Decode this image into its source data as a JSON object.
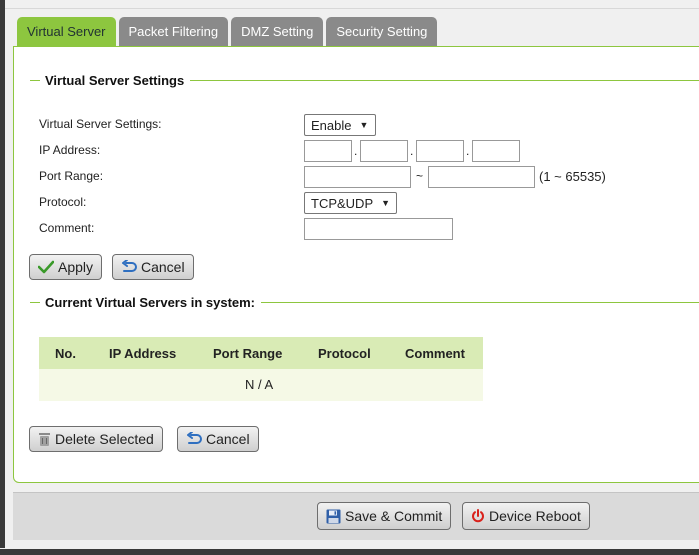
{
  "tabs": [
    {
      "label": "Virtual Server",
      "active": true
    },
    {
      "label": "Packet Filtering",
      "active": false
    },
    {
      "label": "DMZ Setting",
      "active": false
    },
    {
      "label": "Security Setting",
      "active": false
    }
  ],
  "settings_section": {
    "title": "Virtual Server Settings",
    "fields": {
      "virtual_server": {
        "label": "Virtual Server Settings:",
        "value": "Enable"
      },
      "ip_address": {
        "label": "IP Address:",
        "octets": [
          "",
          "",
          "",
          ""
        ],
        "separator": "."
      },
      "port_range": {
        "label": "Port Range:",
        "start": "",
        "end": "",
        "separator": "~",
        "hint": "(1 ~ 65535)"
      },
      "protocol": {
        "label": "Protocol:",
        "value": "TCP&UDP"
      },
      "comment": {
        "label": "Comment:",
        "value": ""
      }
    },
    "apply_label": "Apply",
    "cancel_label": "Cancel"
  },
  "current_section": {
    "title": "Current Virtual Servers in system:",
    "columns": [
      "No.",
      "IP Address",
      "Port Range",
      "Protocol",
      "Comment"
    ],
    "empty_text": "N / A",
    "delete_label": "Delete Selected",
    "cancel_label": "Cancel"
  },
  "bottom_bar": {
    "save_label": "Save & Commit",
    "reboot_label": "Device Reboot"
  },
  "colors": {
    "accent": "#8dc63f",
    "tab_inactive": "#8a8a8a",
    "table_header": "#d9ebb5",
    "table_row": "#f5f9e6",
    "reboot_icon": "#d9221c",
    "save_icon": "#2f5fa8",
    "check_icon": "#3a9a2a"
  },
  "icons": {
    "apply": "check-icon",
    "cancel": "undo-icon",
    "delete": "trash-icon",
    "save": "floppy-disk-icon",
    "reboot": "power-icon"
  }
}
